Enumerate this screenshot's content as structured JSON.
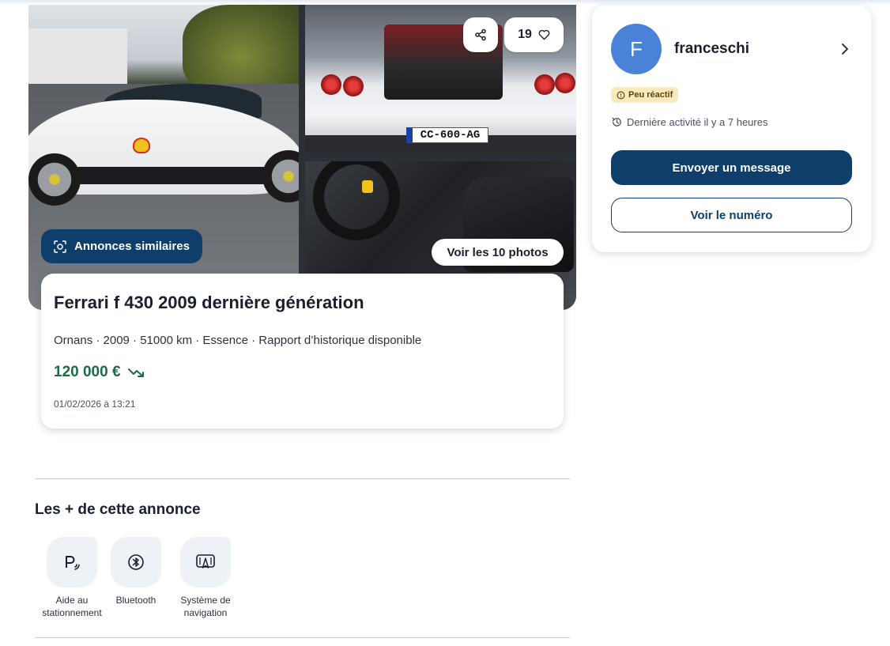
{
  "gallery": {
    "rear_plate_text": "CC-600-AG",
    "similar_ads_label": "Annonces similaires",
    "favorites_count": "19",
    "view_photos_label": "Voir les 10 photos"
  },
  "ad": {
    "title": "Ferrari f 430 2009 dernière génération",
    "meta": "Ornans · 2009 · 51000 km · Essence · Rapport d’historique disponible",
    "price": "120 000 €",
    "date": "01/02/2026 à 13:21"
  },
  "seller": {
    "initial": "F",
    "name": "franceschi",
    "reactivity_badge": "Peu réactif",
    "last_activity": "Dernière activité il y a 7 heures",
    "send_message_label": "Envoyer un message",
    "show_number_label": "Voir le numéro"
  },
  "features": {
    "title": "Les + de cette annonce",
    "items": [
      {
        "label_line1": "Aide au",
        "label_line2": "stationnement",
        "icon": "parking-sensor-icon"
      },
      {
        "label_line1": "Bluetooth",
        "label_line2": "",
        "icon": "bluetooth-icon"
      },
      {
        "label_line1": "Système de",
        "label_line2": "navigation",
        "icon": "navigation-icon"
      }
    ]
  },
  "colors": {
    "primary": "#0e3f6b",
    "price": "#1c6b45",
    "avatar": "#4a82d8",
    "badge_bg": "#fbe9bd"
  }
}
